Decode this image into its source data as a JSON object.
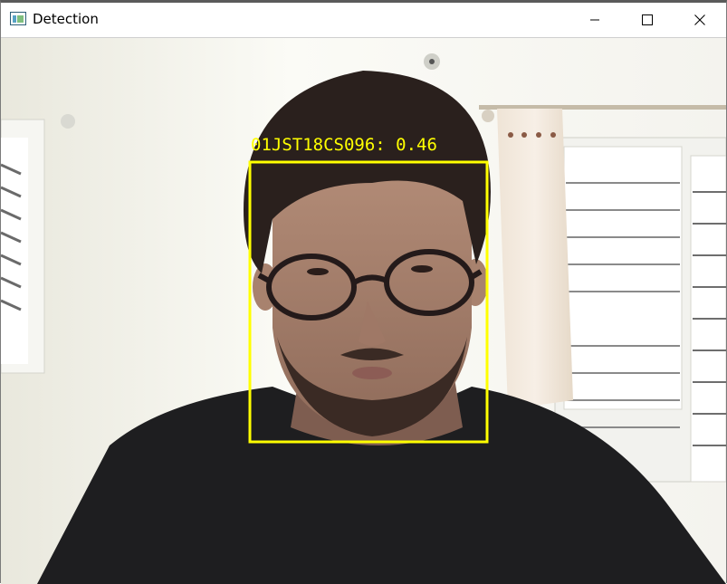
{
  "window": {
    "title": "Detection",
    "icon": "opencv-window-icon",
    "controls": [
      "minimize-icon",
      "maximize-icon",
      "close-icon"
    ]
  },
  "detection": {
    "label": "01JST18CS096: 0.46",
    "box_color": "#ffff00",
    "label_color": "#ffff00"
  },
  "colors": {
    "titlebar": "#ffffff",
    "wall": "#f1f1ea",
    "shirt": "#1e1e20"
  }
}
